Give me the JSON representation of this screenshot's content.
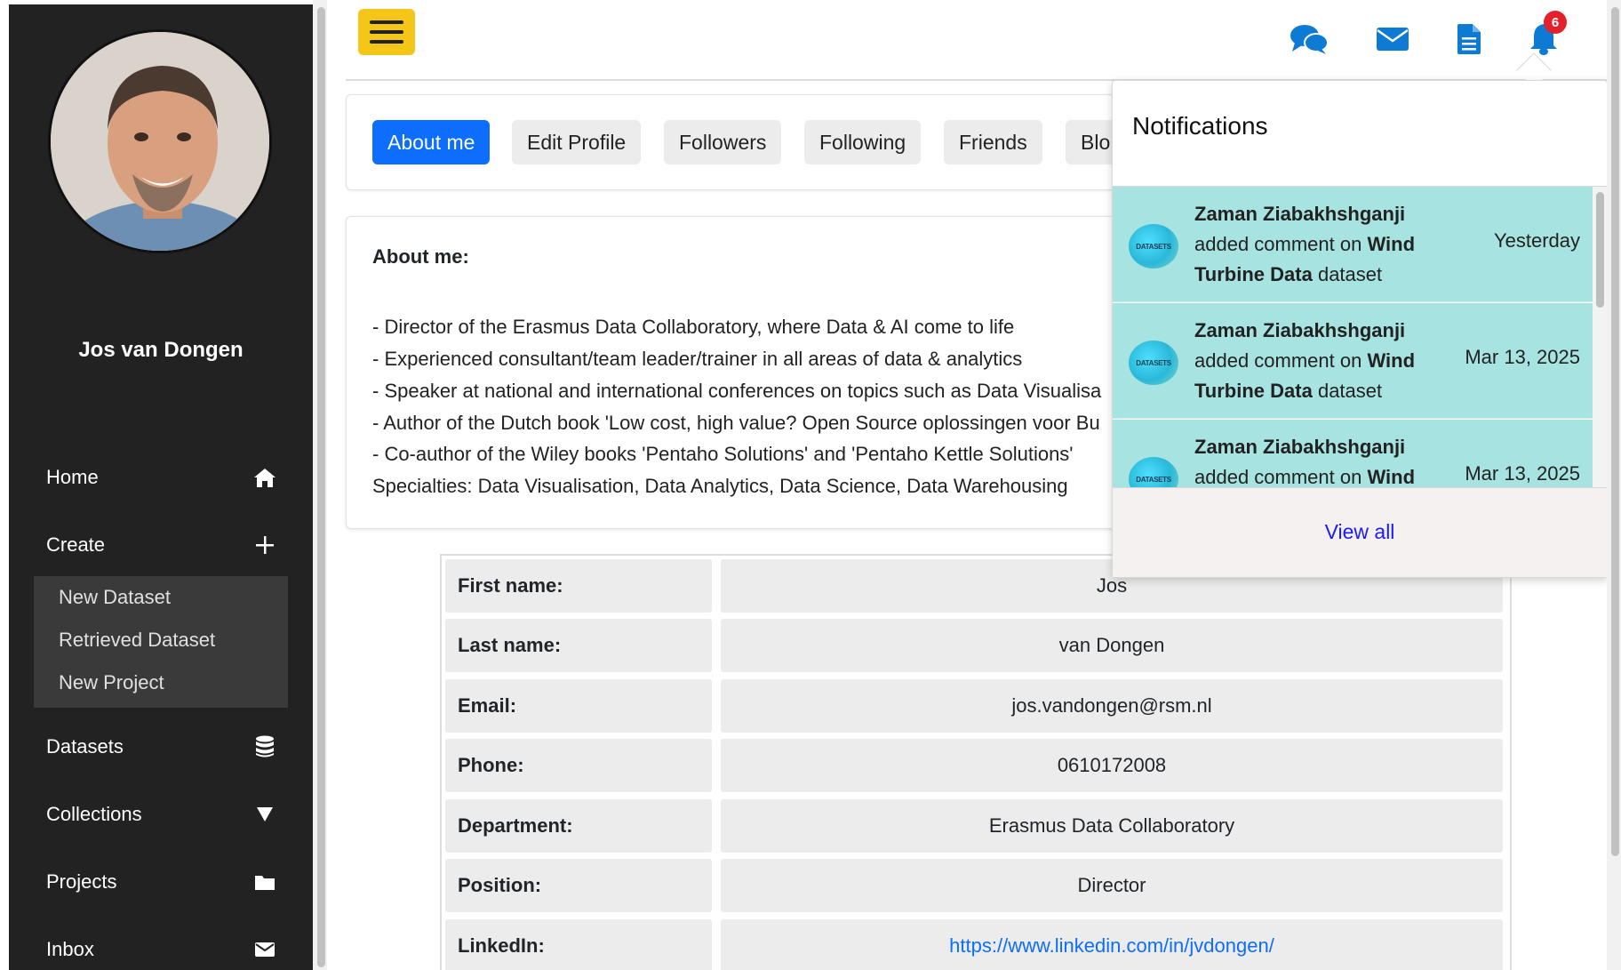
{
  "sidebar": {
    "user_name": "Jos van Dongen",
    "items": [
      {
        "label": "Home",
        "icon": "home-icon"
      },
      {
        "label": "Create",
        "icon": "plus-icon"
      },
      {
        "label": "Datasets",
        "icon": "database-icon"
      },
      {
        "label": "Collections",
        "icon": "triangle-down-icon"
      },
      {
        "label": "Projects",
        "icon": "folder-icon"
      },
      {
        "label": "Inbox",
        "icon": "envelope-icon"
      }
    ],
    "create_submenu": [
      "New Dataset",
      "Retrieved Dataset",
      "New Project"
    ]
  },
  "topbar": {
    "icons": [
      "comments-icon",
      "envelope-icon",
      "document-icon",
      "bell-icon"
    ],
    "notification_count": "6",
    "accent_color": "#f5c518"
  },
  "tabs": [
    {
      "label": "About me",
      "active": true
    },
    {
      "label": "Edit Profile",
      "active": false
    },
    {
      "label": "Followers",
      "active": false
    },
    {
      "label": "Following",
      "active": false
    },
    {
      "label": "Friends",
      "active": false
    },
    {
      "label": "Blo",
      "active": false
    }
  ],
  "about": {
    "heading": "About me:",
    "lines": [
      "- Director of the Erasmus Data Collaboratory, where Data & AI come to life",
      "- Experienced consultant/team leader/trainer in all areas of data & analytics",
      "- Speaker at national and international conferences on topics such as Data Visualisa",
      "- Author of the Dutch book 'Low cost, high value? Open Source oplossingen voor Bu",
      "- Co-author of the Wiley books 'Pentaho Solutions' and 'Pentaho Kettle Solutions'",
      "Specialties: Data Visualisation, Data Analytics, Data Science, Data Warehousing"
    ]
  },
  "profile": {
    "rows": [
      {
        "label": "First name:",
        "value": "Jos"
      },
      {
        "label": "Last name:",
        "value": "van Dongen"
      },
      {
        "label": "Email:",
        "value": "jos.vandongen@rsm.nl"
      },
      {
        "label": "Phone:",
        "value": "0610172008"
      },
      {
        "label": "Department:",
        "value": "Erasmus Data Collaboratory"
      },
      {
        "label": "Position:",
        "value": "Director"
      },
      {
        "label": "LinkedIn:",
        "value": "https://www.linkedin.com/in/jvdongen/"
      }
    ]
  },
  "notifications": {
    "title": "Notifications",
    "logo_text": "DATASETS",
    "items": [
      {
        "user": "Zaman Ziabakhshganji",
        "action": "added comment on",
        "target_a": "Wind",
        "target_b": "Turbine Data",
        "suffix": "dataset",
        "time": "Yesterday"
      },
      {
        "user": "Zaman Ziabakhshganji",
        "action": "added comment on",
        "target_a": "Wind",
        "target_b": "Turbine Data",
        "suffix": "dataset",
        "time": "Mar 13, 2025"
      },
      {
        "user": "Zaman Ziabakhshganji",
        "action": "added comment on",
        "target_a": "Wind",
        "target_b": "",
        "suffix": "",
        "time": "Mar 13, 2025"
      }
    ],
    "view_all": "View all",
    "item_color": "#a7e3e0"
  }
}
